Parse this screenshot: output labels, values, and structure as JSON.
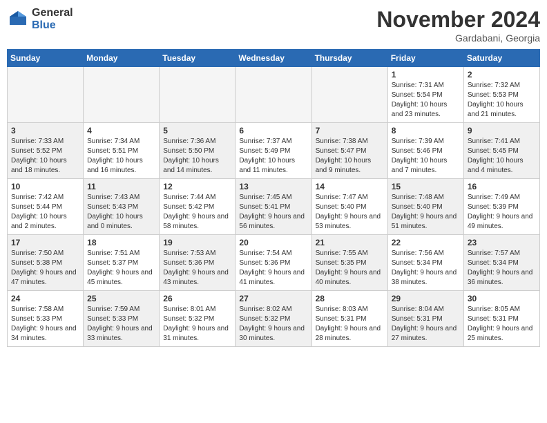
{
  "header": {
    "logo_general": "General",
    "logo_blue": "Blue",
    "month_title": "November 2024",
    "location": "Gardabani, Georgia"
  },
  "weekdays": [
    "Sunday",
    "Monday",
    "Tuesday",
    "Wednesday",
    "Thursday",
    "Friday",
    "Saturday"
  ],
  "weeks": [
    [
      {
        "day": "",
        "empty": true
      },
      {
        "day": "",
        "empty": true
      },
      {
        "day": "",
        "empty": true
      },
      {
        "day": "",
        "empty": true
      },
      {
        "day": "",
        "empty": true
      },
      {
        "day": "1",
        "info": "Sunrise: 7:31 AM\nSunset: 5:54 PM\nDaylight: 10 hours and 23 minutes."
      },
      {
        "day": "2",
        "info": "Sunrise: 7:32 AM\nSunset: 5:53 PM\nDaylight: 10 hours and 21 minutes."
      }
    ],
    [
      {
        "day": "3",
        "shaded": true,
        "info": "Sunrise: 7:33 AM\nSunset: 5:52 PM\nDaylight: 10 hours and 18 minutes."
      },
      {
        "day": "4",
        "info": "Sunrise: 7:34 AM\nSunset: 5:51 PM\nDaylight: 10 hours and 16 minutes."
      },
      {
        "day": "5",
        "shaded": true,
        "info": "Sunrise: 7:36 AM\nSunset: 5:50 PM\nDaylight: 10 hours and 14 minutes."
      },
      {
        "day": "6",
        "info": "Sunrise: 7:37 AM\nSunset: 5:49 PM\nDaylight: 10 hours and 11 minutes."
      },
      {
        "day": "7",
        "shaded": true,
        "info": "Sunrise: 7:38 AM\nSunset: 5:47 PM\nDaylight: 10 hours and 9 minutes."
      },
      {
        "day": "8",
        "info": "Sunrise: 7:39 AM\nSunset: 5:46 PM\nDaylight: 10 hours and 7 minutes."
      },
      {
        "day": "9",
        "shaded": true,
        "info": "Sunrise: 7:41 AM\nSunset: 5:45 PM\nDaylight: 10 hours and 4 minutes."
      }
    ],
    [
      {
        "day": "10",
        "info": "Sunrise: 7:42 AM\nSunset: 5:44 PM\nDaylight: 10 hours and 2 minutes."
      },
      {
        "day": "11",
        "shaded": true,
        "info": "Sunrise: 7:43 AM\nSunset: 5:43 PM\nDaylight: 10 hours and 0 minutes."
      },
      {
        "day": "12",
        "info": "Sunrise: 7:44 AM\nSunset: 5:42 PM\nDaylight: 9 hours and 58 minutes."
      },
      {
        "day": "13",
        "shaded": true,
        "info": "Sunrise: 7:45 AM\nSunset: 5:41 PM\nDaylight: 9 hours and 56 minutes."
      },
      {
        "day": "14",
        "info": "Sunrise: 7:47 AM\nSunset: 5:40 PM\nDaylight: 9 hours and 53 minutes."
      },
      {
        "day": "15",
        "shaded": true,
        "info": "Sunrise: 7:48 AM\nSunset: 5:40 PM\nDaylight: 9 hours and 51 minutes."
      },
      {
        "day": "16",
        "info": "Sunrise: 7:49 AM\nSunset: 5:39 PM\nDaylight: 9 hours and 49 minutes."
      }
    ],
    [
      {
        "day": "17",
        "shaded": true,
        "info": "Sunrise: 7:50 AM\nSunset: 5:38 PM\nDaylight: 9 hours and 47 minutes."
      },
      {
        "day": "18",
        "info": "Sunrise: 7:51 AM\nSunset: 5:37 PM\nDaylight: 9 hours and 45 minutes."
      },
      {
        "day": "19",
        "shaded": true,
        "info": "Sunrise: 7:53 AM\nSunset: 5:36 PM\nDaylight: 9 hours and 43 minutes."
      },
      {
        "day": "20",
        "info": "Sunrise: 7:54 AM\nSunset: 5:36 PM\nDaylight: 9 hours and 41 minutes."
      },
      {
        "day": "21",
        "shaded": true,
        "info": "Sunrise: 7:55 AM\nSunset: 5:35 PM\nDaylight: 9 hours and 40 minutes."
      },
      {
        "day": "22",
        "info": "Sunrise: 7:56 AM\nSunset: 5:34 PM\nDaylight: 9 hours and 38 minutes."
      },
      {
        "day": "23",
        "shaded": true,
        "info": "Sunrise: 7:57 AM\nSunset: 5:34 PM\nDaylight: 9 hours and 36 minutes."
      }
    ],
    [
      {
        "day": "24",
        "info": "Sunrise: 7:58 AM\nSunset: 5:33 PM\nDaylight: 9 hours and 34 minutes."
      },
      {
        "day": "25",
        "shaded": true,
        "info": "Sunrise: 7:59 AM\nSunset: 5:33 PM\nDaylight: 9 hours and 33 minutes."
      },
      {
        "day": "26",
        "info": "Sunrise: 8:01 AM\nSunset: 5:32 PM\nDaylight: 9 hours and 31 minutes."
      },
      {
        "day": "27",
        "shaded": true,
        "info": "Sunrise: 8:02 AM\nSunset: 5:32 PM\nDaylight: 9 hours and 30 minutes."
      },
      {
        "day": "28",
        "info": "Sunrise: 8:03 AM\nSunset: 5:31 PM\nDaylight: 9 hours and 28 minutes."
      },
      {
        "day": "29",
        "shaded": true,
        "info": "Sunrise: 8:04 AM\nSunset: 5:31 PM\nDaylight: 9 hours and 27 minutes."
      },
      {
        "day": "30",
        "info": "Sunrise: 8:05 AM\nSunset: 5:31 PM\nDaylight: 9 hours and 25 minutes."
      }
    ]
  ]
}
